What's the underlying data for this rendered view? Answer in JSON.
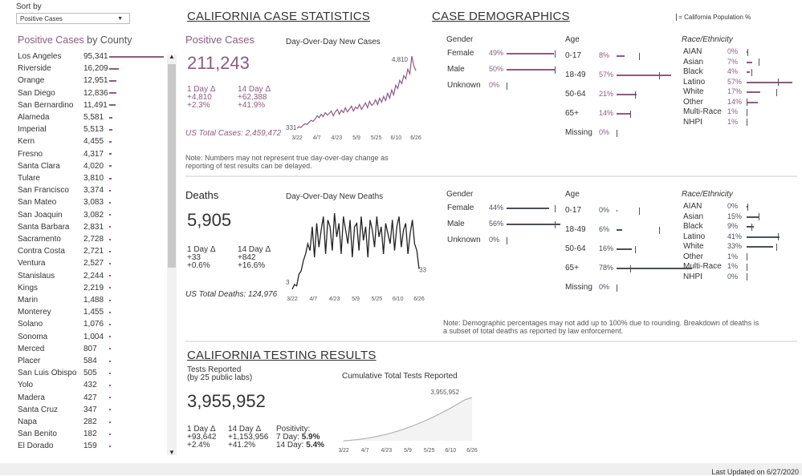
{
  "sort": {
    "label": "Sort by",
    "value": "Positive Cases"
  },
  "county_panel": {
    "title_colored": "Positive Cases",
    "title_rest": " by County",
    "rows": [
      [
        "Los Angeles",
        "95,341",
        95341
      ],
      [
        "Riverside",
        "16,209",
        16209
      ],
      [
        "Orange",
        "12,951",
        12951
      ],
      [
        "San Diego",
        "12,836",
        12836
      ],
      [
        "San Bernardino",
        "11,491",
        11491
      ],
      [
        "Alameda",
        "5,581",
        5581
      ],
      [
        "Imperial",
        "5,513",
        5513
      ],
      [
        "Kern",
        "4,455",
        4455
      ],
      [
        "Fresno",
        "4,317",
        4317
      ],
      [
        "Santa Clara",
        "4,020",
        4020
      ],
      [
        "Tulare",
        "3,810",
        3810
      ],
      [
        "San Francisco",
        "3,374",
        3374
      ],
      [
        "San Mateo",
        "3,083",
        3083
      ],
      [
        "San Joaquin",
        "3,082",
        3082
      ],
      [
        "Santa Barbara",
        "2,831",
        2831
      ],
      [
        "Sacramento",
        "2,728",
        2728
      ],
      [
        "Contra Costa",
        "2,721",
        2721
      ],
      [
        "Ventura",
        "2,527",
        2527
      ],
      [
        "Stanislaus",
        "2,244",
        2244
      ],
      [
        "Kings",
        "2,219",
        2219
      ],
      [
        "Marin",
        "1,488",
        1488
      ],
      [
        "Monterey",
        "1,455",
        1455
      ],
      [
        "Solano",
        "1,076",
        1076
      ],
      [
        "Sonoma",
        "1,004",
        1004
      ],
      [
        "Merced",
        "807",
        807
      ],
      [
        "Placer",
        "584",
        584
      ],
      [
        "San Luis Obispo",
        "505",
        505
      ],
      [
        "Yolo",
        "432",
        432
      ],
      [
        "Madera",
        "427",
        427
      ],
      [
        "Santa Cruz",
        "347",
        347
      ],
      [
        "Napa",
        "282",
        282
      ],
      [
        "San Benito",
        "182",
        182
      ],
      [
        "El Dorado",
        "159",
        159
      ]
    ]
  },
  "case_stats_title": "CALIFORNIA CASE STATISTICS",
  "demographics_title": "CASE DEMOGRAPHICS",
  "legend_text": "= California Population %",
  "cases": {
    "title": "Positive Cases",
    "total": "211,243",
    "d1_label": "1 Day Δ",
    "d1_abs": "+4,810",
    "d1_pct": "+2.3%",
    "d14_label": "14 Day Δ",
    "d14_abs": "+62,388",
    "d14_pct": "+41.9%",
    "us_total": "US Total Cases: 2,459,472",
    "chart_title": "Day-Over-Day New Cases",
    "note": "Note: Numbers may not represent true day-over-day change as reporting of test results can be delayed."
  },
  "deaths": {
    "title": "Deaths",
    "total": "5,905",
    "d1_label": "1 Day Δ",
    "d1_abs": "+33",
    "d1_pct": "+0.6%",
    "d14_label": "14 Day Δ",
    "d14_abs": "+842",
    "d14_pct": "+16.6%",
    "us_total": "US Total Deaths: 124,976",
    "chart_title": "Day-Over-Day New Deaths"
  },
  "testing": {
    "section_title": "CALIFORNIA TESTING RESULTS",
    "label1": "Tests Reported",
    "label2": "(by 25 public labs)",
    "total": "3,955,952",
    "d1_label": "1 Day Δ",
    "d1_abs": "+93,642",
    "d1_pct": "+2.4%",
    "d14_label": "14 Day Δ",
    "d14_abs": "+1,153,956",
    "d14_pct": "+41.2%",
    "pos_label": "Positivity:",
    "pos7_label": "7 Day:",
    "pos7": "5.9%",
    "pos14_label": "14 Day:",
    "pos14": "5.4%",
    "chart_title": "Cumulative Total Tests Reported"
  },
  "x_ticks": [
    "3/22",
    "4/7",
    "4/23",
    "5/9",
    "5/25",
    "6/10",
    "6/26"
  ],
  "chart_data": [
    {
      "type": "line",
      "title": "Day-Over-Day New Cases",
      "x_ticks": [
        "3/22",
        "4/7",
        "4/23",
        "5/9",
        "5/25",
        "6/10",
        "6/26"
      ],
      "annotations": {
        "start": "331",
        "max": "4,810"
      },
      "values": [
        331,
        420,
        380,
        520,
        610,
        560,
        700,
        820,
        760,
        900,
        1100,
        980,
        1200,
        1050,
        1300,
        1150,
        1250,
        1400,
        1100,
        1350,
        1500,
        1200,
        1450,
        1300,
        1600,
        1350,
        1500,
        1700,
        1400,
        1650,
        1550,
        1800,
        1500,
        1700,
        1900,
        1600,
        2000,
        1750,
        1850,
        2100,
        1800,
        2200,
        1950,
        2300,
        2050,
        2500,
        2200,
        2700,
        2400,
        3000,
        2800,
        3300,
        3100,
        3600,
        3400,
        4000,
        3700,
        4810,
        4200,
        3900
      ]
    },
    {
      "type": "line",
      "title": "Day-Over-Day New Deaths",
      "x_ticks": [
        "3/22",
        "4/7",
        "4/23",
        "5/9",
        "5/25",
        "6/10",
        "6/26"
      ],
      "annotations": {
        "start": "3",
        "end": "33"
      },
      "values": [
        3,
        10,
        8,
        25,
        30,
        45,
        55,
        70,
        60,
        95,
        50,
        100,
        65,
        90,
        110,
        55,
        105,
        95,
        60,
        115,
        80,
        100,
        55,
        110,
        90,
        70,
        105,
        50,
        95,
        100,
        60,
        110,
        75,
        95,
        50,
        105,
        90,
        65,
        110,
        80,
        95,
        55,
        100,
        85,
        70,
        105,
        60,
        95,
        110,
        65,
        90,
        100,
        55,
        85,
        105,
        70,
        60,
        33
      ]
    },
    {
      "type": "area",
      "title": "Cumulative Total Tests Reported",
      "x_ticks": [
        "3/22",
        "4/7",
        "4/23",
        "5/9",
        "5/25",
        "6/10",
        "6/26"
      ],
      "annotations": {
        "end": "3,955,952"
      },
      "values": [
        20000,
        60000,
        120000,
        200000,
        300000,
        420000,
        560000,
        720000,
        900000,
        1100000,
        1320000,
        1560000,
        1820000,
        2100000,
        2400000,
        2720000,
        3050000,
        3400000,
        3760000,
        3955952
      ]
    }
  ],
  "case_demo": {
    "gender_title": "Gender",
    "gender": [
      [
        "Female",
        "49%",
        49,
        50
      ],
      [
        "Male",
        "50%",
        50,
        50
      ],
      [
        "Unknown",
        "0%",
        0,
        0
      ]
    ],
    "age_title": "Age",
    "age": [
      [
        "0-17",
        "8%",
        8,
        23
      ],
      [
        "18-49",
        "57%",
        57,
        44
      ],
      [
        "50-64",
        "21%",
        21,
        19
      ],
      [
        "65+",
        "14%",
        14,
        14
      ],
      [
        "Missing",
        "0%",
        0,
        0
      ]
    ],
    "race_title": "Race/Ethnicity",
    "race": [
      [
        "AIAN",
        "0%",
        0,
        1
      ],
      [
        "Asian",
        "7%",
        7,
        15
      ],
      [
        "Black",
        "4%",
        4,
        6
      ],
      [
        "Latino",
        "57%",
        57,
        39
      ],
      [
        "White",
        "17%",
        17,
        37
      ],
      [
        "Other",
        "14%",
        14,
        0
      ],
      [
        "Multi-Race",
        "1%",
        1,
        0
      ],
      [
        "NHPI",
        "1%",
        1,
        0
      ]
    ]
  },
  "death_demo": {
    "gender_title": "Gender",
    "gender": [
      [
        "Female",
        "44%",
        44,
        50
      ],
      [
        "Male",
        "56%",
        56,
        50
      ],
      [
        "Unknown",
        "0%",
        0,
        0
      ]
    ],
    "age_title": "Age",
    "age": [
      [
        "0-17",
        "0%",
        0,
        23
      ],
      [
        "18-49",
        "6%",
        6,
        44
      ],
      [
        "50-64",
        "16%",
        16,
        19
      ],
      [
        "65+",
        "78%",
        78,
        14
      ],
      [
        "Missing",
        "0%",
        0,
        0
      ]
    ],
    "race_title": "Race/Ethnicity",
    "race": [
      [
        "AIAN",
        "0%",
        0,
        1
      ],
      [
        "Asian",
        "15%",
        15,
        15
      ],
      [
        "Black",
        "9%",
        9,
        6
      ],
      [
        "Latino",
        "41%",
        41,
        39
      ],
      [
        "White",
        "33%",
        33,
        37
      ],
      [
        "Other",
        "1%",
        1,
        0
      ],
      [
        "Multi-Race",
        "1%",
        1,
        0
      ],
      [
        "NHPI",
        "0%",
        0,
        0
      ]
    ]
  },
  "demo_note": "Note: Demographic percentages may not add up to 100% due to rounding. Breakdown of deaths is a subset of total deaths as reported by law enforcement.",
  "footer": "Last Updated on 6/27/2020",
  "colors": {
    "cases": "#8e5a82",
    "deaths": "#4a4f5a",
    "tests": "#b3b3b3"
  }
}
